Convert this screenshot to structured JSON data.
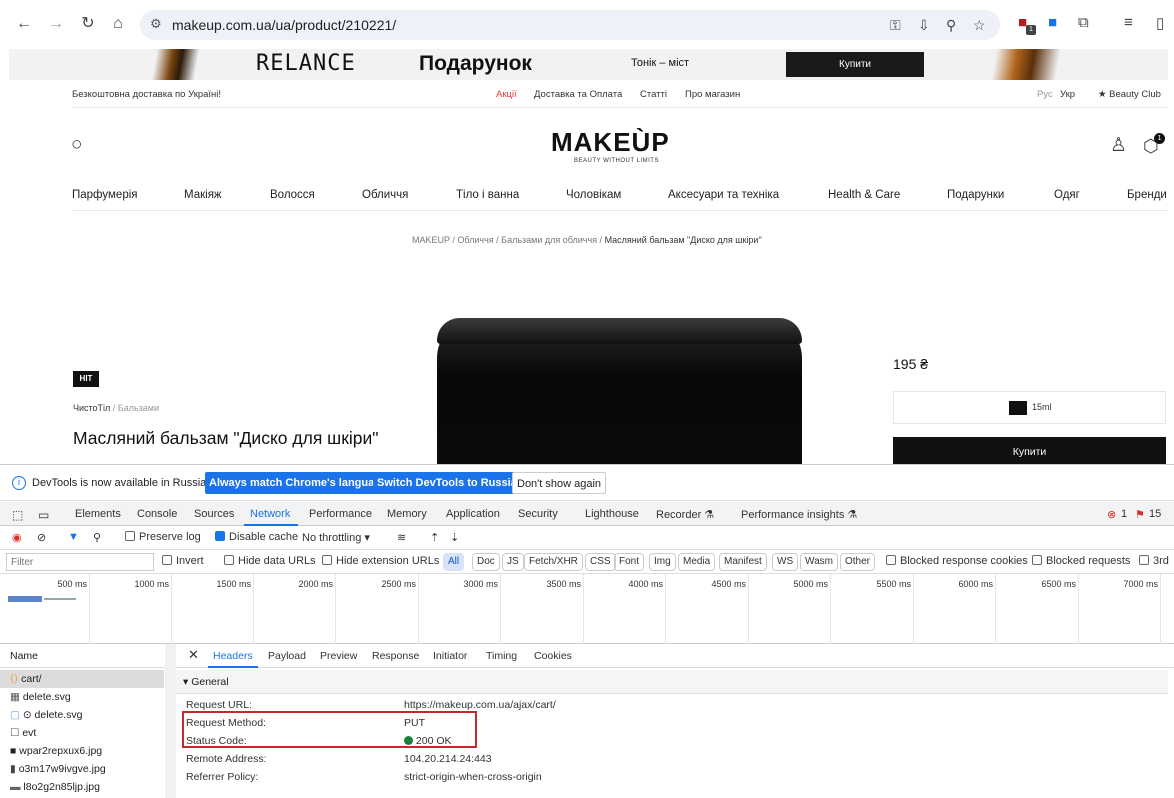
{
  "browser": {
    "url": "makeup.com.ua/ua/product/210221/",
    "ext_badge": "1"
  },
  "banner": {
    "brand": "RELANCE",
    "gift": "Подарунок",
    "sub": "Тонік – міст",
    "buy": "Купити"
  },
  "header": {
    "free_delivery": "Безкоштовна доставка по Україні!",
    "links": [
      "Акції",
      "Доставка та Оплата",
      "Статті",
      "Про магазин"
    ],
    "lang_ru": "Рус",
    "lang_ua": "Укр",
    "beauty_club": "★ Beauty Club",
    "logo": "MAKEÙP",
    "logo_sub": "BEAUTY WITHOUT LIMITS",
    "cart_count": "1"
  },
  "menu": [
    "Парфумерія",
    "Макіяж",
    "Волосся",
    "Обличчя",
    "Тіло і ванна",
    "Чоловікам",
    "Аксесуари та техніка",
    "Health & Care",
    "Подарунки",
    "Одяг",
    "Бренди"
  ],
  "breadcrumb": {
    "items": [
      "MAKEUP",
      "Обличчя",
      "Бальзами для обличчя"
    ],
    "sep": " / ",
    "current": "Масляний бальзам \"Диско для шкіри\""
  },
  "product": {
    "badge": "HIT",
    "brand": "ЧистоТіл",
    "category": " / Бальзами",
    "title": "Масляний бальзам \"Диско для шкіри\"",
    "price": "195 ₴",
    "volume": "15ml",
    "buy": "Купити"
  },
  "devtools": {
    "info_msg": "DevTools is now available in Russian!",
    "btn_match": "Always match Chrome's language",
    "btn_switch": "Switch DevTools to Russian",
    "btn_dismiss": "Don't show again",
    "tabs": [
      "Elements",
      "Console",
      "Sources",
      "Network",
      "Performance",
      "Memory",
      "Application",
      "Security",
      "Lighthouse",
      "Recorder ⚗",
      "Performance insights ⚗"
    ],
    "errors": "1",
    "issues": "15",
    "toolbar": {
      "preserve_log": "Preserve log",
      "disable_cache": "Disable cache",
      "throttling": "No throttling"
    },
    "filter_placeholder": "Filter",
    "filter_opts": [
      "Invert",
      "Hide data URLs",
      "Hide extension URLs"
    ],
    "chips": [
      "All",
      "Doc",
      "JS",
      "Fetch/XHR",
      "CSS",
      "Font",
      "Img",
      "Media",
      "Manifest",
      "WS",
      "Wasm",
      "Other"
    ],
    "blocked_cookies": "Blocked response cookies",
    "blocked_requests": "Blocked requests",
    "third_party": "3rd",
    "timeline_labels": [
      "500 ms",
      "1000 ms",
      "1500 ms",
      "2000 ms",
      "2500 ms",
      "3000 ms",
      "3500 ms",
      "4000 ms",
      "4500 ms",
      "5000 ms",
      "5500 ms",
      "6000 ms",
      "6500 ms",
      "7000 ms"
    ],
    "list_header": "Name",
    "requests": [
      "cart/",
      "delete.svg",
      "⊙ delete.svg",
      "evt",
      "wpar2repxux6.jpg",
      "o3m17w9ivgve.jpg",
      "l8o2g2n85ljp.jpg"
    ],
    "detail_tabs": [
      "Headers",
      "Payload",
      "Preview",
      "Response",
      "Initiator",
      "Timing",
      "Cookies"
    ],
    "general": "▾ General",
    "headers": [
      {
        "k": "Request URL:",
        "v": "https://makeup.com.ua/ajax/cart/"
      },
      {
        "k": "Request Method:",
        "v": "PUT"
      },
      {
        "k": "Status Code:",
        "v": "200 OK"
      },
      {
        "k": "Remote Address:",
        "v": "104.20.214.24:443"
      },
      {
        "k": "Referrer Policy:",
        "v": "strict-origin-when-cross-origin"
      }
    ]
  }
}
